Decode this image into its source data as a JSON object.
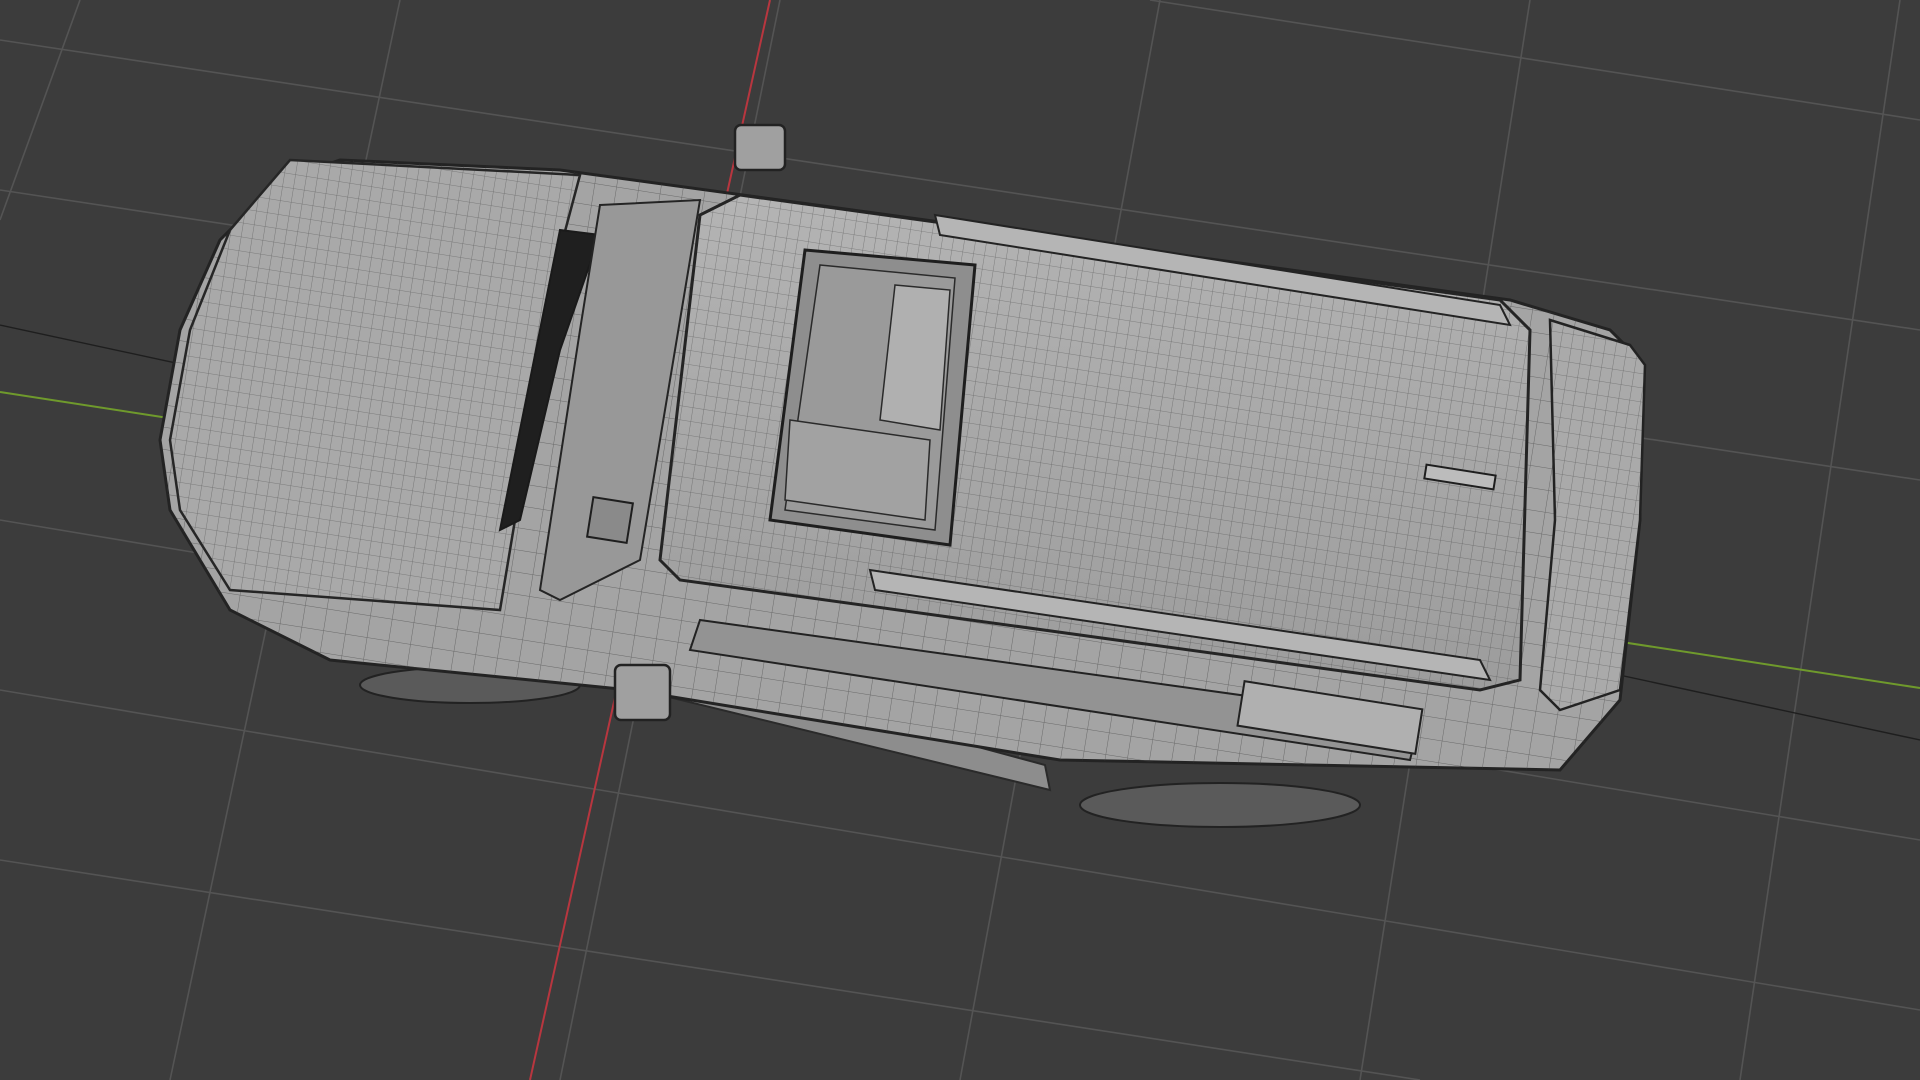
{
  "viewport": {
    "background": "#3c3c3c",
    "grid_color": "#545454",
    "x_axis_color": "#b8363f",
    "y_axis_color": "#6f9a2c",
    "mesh_body_color": "#a7a7a7",
    "mesh_shadow_color": "#7c7c7c",
    "wire_color": "#2e2e2e"
  }
}
